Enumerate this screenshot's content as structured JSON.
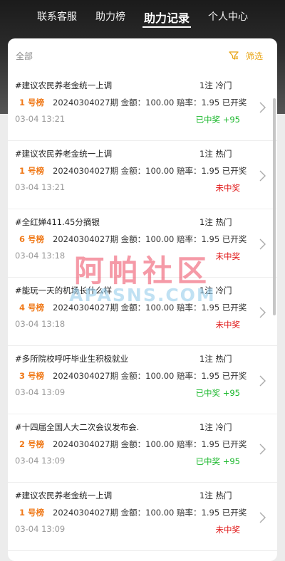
{
  "nav": {
    "tabs": [
      {
        "label": "联系客服",
        "active": false
      },
      {
        "label": "助力榜",
        "active": false
      },
      {
        "label": "助力记录",
        "active": true
      },
      {
        "label": "个人中心",
        "active": false
      }
    ]
  },
  "filter": {
    "all_label": "全部",
    "filter_label": "筛选"
  },
  "records": [
    {
      "title": "#建议农民养老金统一上调",
      "count": "1注  冷门",
      "board": "1 号榜",
      "info": "20240304027期  金额：100.00  赔率：1.95  已开奖",
      "time": "03-04 13:21",
      "result": "已中奖 +95",
      "status": "win"
    },
    {
      "title": "#建议农民养老金统一上调",
      "count": "1注  热门",
      "board": "1 号榜",
      "info": "20240304027期  金额：100.00  赔率：1.95  已开奖",
      "time": "03-04 13:21",
      "result": "未中奖",
      "status": "lose"
    },
    {
      "title": "#全红婵411.45分摘银",
      "count": "1注  热门",
      "board": "6 号榜",
      "info": "20240304027期  金额：100.00  赔率：1.95  已开奖",
      "time": "03-04 13:18",
      "result": "未中奖",
      "status": "lose"
    },
    {
      "title": "#能玩一天的机场长什么样",
      "count": "1注  冷门",
      "board": "4 号榜",
      "info": "20240304027期  金额：100.00  赔率：1.95  已开奖",
      "time": "03-04 13:18",
      "result": "未中奖",
      "status": "lose"
    },
    {
      "title": "#多所院校呼吁毕业生积极就业",
      "count": "1注  热门",
      "board": "3 号榜",
      "info": "20240304027期  金额：100.00  赔率：1.95  已开奖",
      "time": "03-04 13:09",
      "result": "已中奖 +95",
      "status": "win"
    },
    {
      "title": "#十四届全国人大二次会议发布会.",
      "count": "1注  冷门",
      "board": "2 号榜",
      "info": "20240304027期  金额：100.00  赔率：1.95  已开奖",
      "time": "03-04 13:09",
      "result": "已中奖 +95",
      "status": "win"
    },
    {
      "title": "#建议农民养老金统一上调",
      "count": "1注  热门",
      "board": "1 号榜",
      "info": "20240304027期  金额：100.00  赔率：1.95  已开奖",
      "time": "03-04 13:09",
      "result": "未中奖",
      "status": "lose"
    }
  ],
  "watermark": {
    "text_cn": "阿帕社区",
    "text_en": "APASNS.COM"
  },
  "colors": {
    "accent": "#e8a516",
    "board": "#f07a1a",
    "win": "#1bb82c",
    "lose": "#e01515"
  },
  "icons": {
    "filter": "filter-funnel-icon",
    "row_arrow": "chevron-right-icon"
  }
}
